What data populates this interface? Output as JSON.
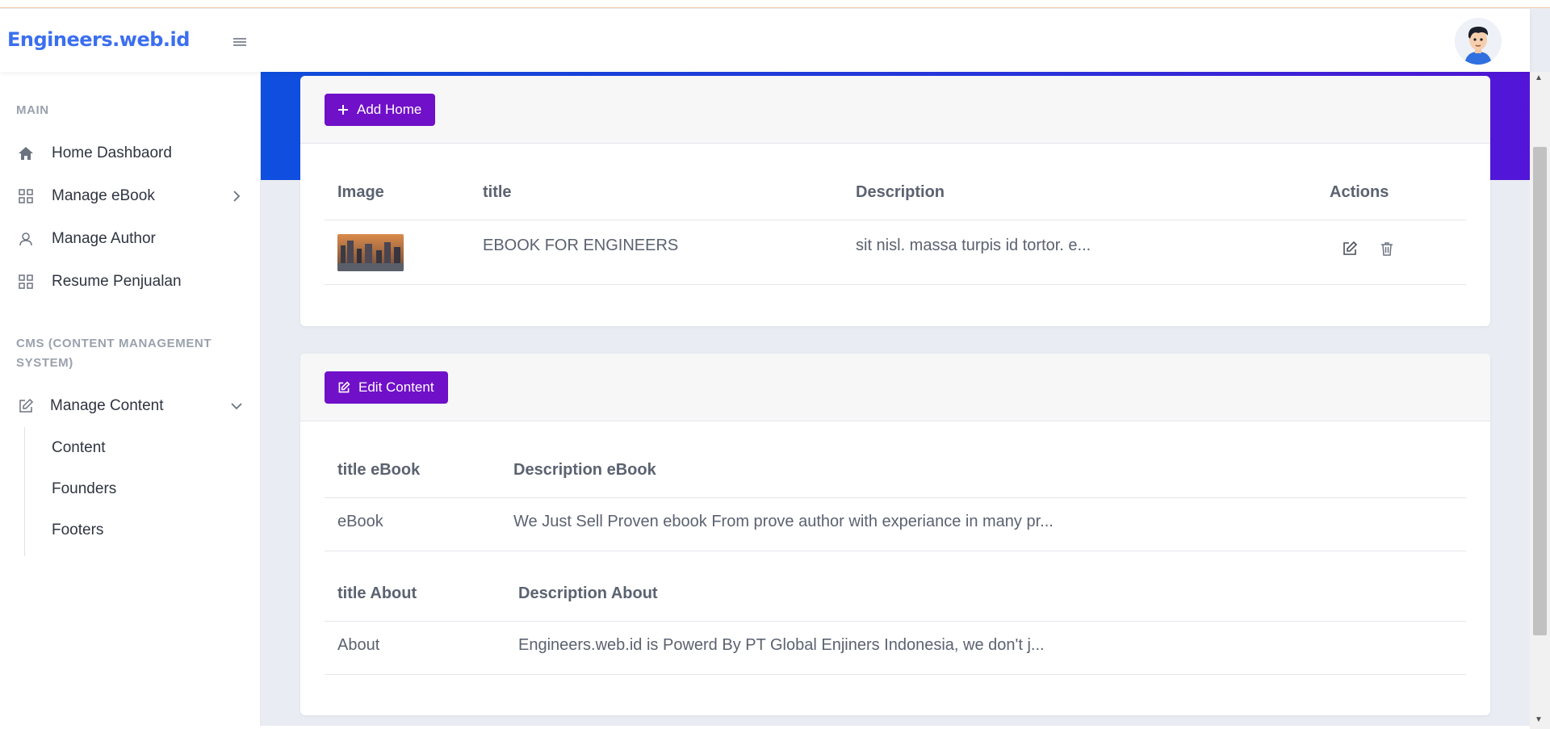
{
  "header": {
    "logo": "Engineers.web.id"
  },
  "sidebar": {
    "main_section": "MAIN",
    "items": [
      {
        "label": "Home Dashbaord"
      },
      {
        "label": "Manage eBook"
      },
      {
        "label": "Manage Author"
      },
      {
        "label": "Resume Penjualan"
      }
    ],
    "cms_section": "CMS (CONTENT MANAGEMENT SYSTEM)",
    "cms_items": [
      {
        "label": "Manage Content"
      }
    ],
    "sub_items": [
      {
        "label": "Content"
      },
      {
        "label": "Founders"
      },
      {
        "label": "Footers"
      }
    ]
  },
  "home_card": {
    "button_label": "Add Home",
    "columns": [
      "Image",
      "title",
      "Description",
      "Actions"
    ],
    "rows": [
      {
        "title": "EBOOK FOR ENGINEERS",
        "description": "sit nisl. massa turpis id tortor. e..."
      }
    ]
  },
  "content_card": {
    "button_label": "Edit Content",
    "ebook_columns": [
      "title eBook",
      "Description eBook"
    ],
    "ebook_row": {
      "title": "eBook",
      "description": "We Just Sell Proven ebook From prove author with experiance in many pr..."
    },
    "about_columns": [
      "title About",
      "Description About"
    ],
    "about_row": {
      "title": "About",
      "description": "Engineers.web.id is Powerd By PT Global Enjiners Indonesia, we don't j..."
    }
  },
  "colors": {
    "brand": "#3b6ff0",
    "button": "#7010c8",
    "banner_start": "#0f4fe0",
    "banner_end": "#5315d8"
  }
}
